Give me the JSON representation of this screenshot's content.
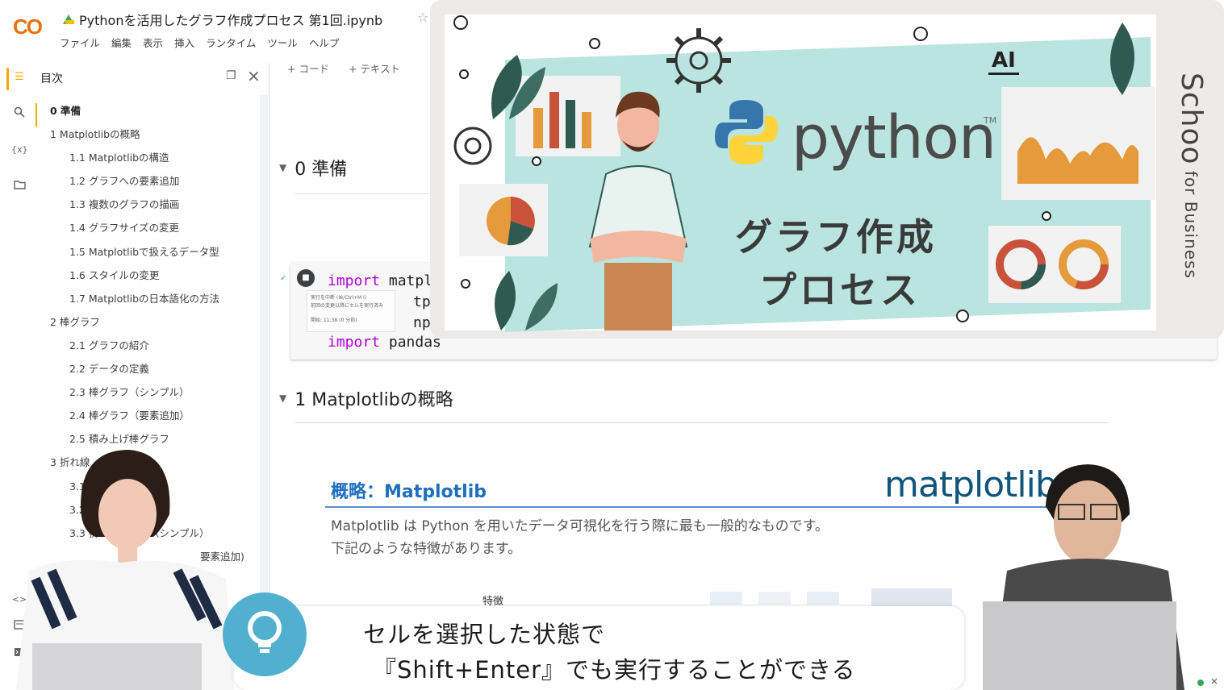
{
  "app": {
    "logo": "CO",
    "notebook_title": "Pythonを活用したグラフ作成プロセス 第1回.ipynb",
    "menu": [
      "ファイル",
      "編集",
      "表示",
      "挿入",
      "ランタイム",
      "ツール",
      "ヘルプ"
    ]
  },
  "toc": {
    "title": "目次",
    "items": [
      {
        "label": "0 準備",
        "level": 1
      },
      {
        "label": "1 Matplotlibの概略",
        "level": 1
      },
      {
        "label": "1.1 Matplotlibの構造",
        "level": 2
      },
      {
        "label": "1.2 グラフへの要素追加",
        "level": 2
      },
      {
        "label": "1.3 複数のグラフの描画",
        "level": 2
      },
      {
        "label": "1.4 グラフサイズの変更",
        "level": 2
      },
      {
        "label": "1.5 Matplotlibで扱えるデータ型",
        "level": 2
      },
      {
        "label": "1.6 スタイルの変更",
        "level": 2
      },
      {
        "label": "1.7 Matplotlibの日本語化の方法",
        "level": 2
      },
      {
        "label": "2 棒グラフ",
        "level": 1
      },
      {
        "label": "2.1 グラフの紹介",
        "level": 2
      },
      {
        "label": "2.2 データの定義",
        "level": 2
      },
      {
        "label": "2.3 棒グラフ（シンプル）",
        "level": 2
      },
      {
        "label": "2.4 棒グラフ（要素追加）",
        "level": 2
      },
      {
        "label": "2.5 積み上げ棒グラフ",
        "level": 2
      },
      {
        "label": "3 折れ線",
        "level": 1
      },
      {
        "label": "3.1",
        "level": 2
      },
      {
        "label": "3.2",
        "level": 2
      },
      {
        "label": "3.3 折れ線グラフ（シンプル）",
        "level": 2
      },
      {
        "label": "要素追加)",
        "level": 2
      }
    ]
  },
  "toolbar": {
    "code": "+ コード",
    "text": "+ テキスト"
  },
  "sections": {
    "prep": "0 準備",
    "matplotlib": "1 Matplotlibの概略"
  },
  "code": {
    "line1_kw": "import",
    "line1_rest": " matpl",
    "line2_rest": "tpl",
    "line3_rest": "np",
    "line4_kw": "import",
    "line4_rest": " pandas"
  },
  "tooltip": {
    "line1": "実行を中断 (⌘/Ctrl+M I)",
    "line2": "前回の変更以降にセルを実行済み",
    "line3": "開始: 11:38 (0 分前)"
  },
  "slide": {
    "title": "概略：Matplotlib",
    "text1": "Matplotlib は Python を用いたデータ可視化を行う際に最も一般的なものです。",
    "text2": "下記のような特徴があります。",
    "logo": "matplotlib",
    "feature_label": "特徴"
  },
  "banner": {
    "python_word": "python",
    "tm": "TM",
    "line1": "グラフ作成",
    "line2": "プロセス",
    "ai": "AI",
    "brand": "Schoo",
    "brand_sub": " for Business"
  },
  "caption": {
    "line1": "セルを選択した状態で",
    "line2": "『Shift+Enter』でも実行することができる"
  },
  "colors": {
    "colab_orange": "#f9ab00",
    "keyword": "#af00db",
    "slide_title": "#1f6fbf",
    "banner_mint": "#b9e4df"
  }
}
